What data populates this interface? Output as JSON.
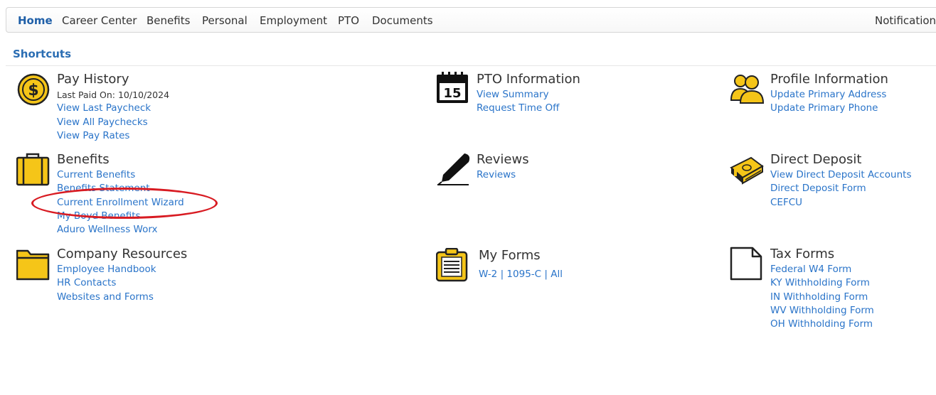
{
  "nav": {
    "items": [
      "Home",
      "Career Center",
      "Benefits",
      "Personal",
      "Employment",
      "PTO",
      "Documents"
    ],
    "right": "Notifications"
  },
  "shortcuts": {
    "title": "Shortcuts",
    "pay_history": {
      "icon": "dollar-coin-icon",
      "title": "Pay History",
      "meta": "Last Paid On: 10/10/2024",
      "links": [
        "View Last Paycheck",
        "View All Paychecks",
        "View Pay Rates"
      ]
    },
    "pto_information": {
      "icon": "calendar-icon",
      "calendar_day": "15",
      "title": "PTO Information",
      "links": [
        "View Summary",
        "Request Time Off"
      ]
    },
    "profile_information": {
      "icon": "people-icon",
      "title": "Profile Information",
      "links": [
        "Update Primary Address",
        "Update Primary Phone"
      ]
    },
    "benefits": {
      "icon": "briefcase-icon",
      "title": "Benefits",
      "links": [
        "Current Benefits",
        "Benefits Statement",
        "Current Enrollment Wizard",
        "My Boyd Benefits",
        "Aduro Wellness Worx"
      ]
    },
    "reviews": {
      "icon": "pen-icon",
      "title": "Reviews",
      "links": [
        "Reviews"
      ]
    },
    "direct_deposit": {
      "icon": "money-stack-icon",
      "title": "Direct Deposit",
      "links": [
        "View Direct Deposit Accounts",
        "Direct Deposit Form",
        "CEFCU"
      ]
    },
    "company_resources": {
      "icon": "folder-icon",
      "title": "Company Resources",
      "links": [
        "Employee Handbook",
        "HR Contacts",
        "Websites and Forms"
      ]
    },
    "my_forms": {
      "icon": "clipboard-icon",
      "title": "My Forms",
      "links": [
        "W-2",
        "1095-C",
        "All"
      ],
      "separator": "|"
    },
    "tax_forms": {
      "icon": "document-icon",
      "title": "Tax Forms",
      "links": [
        "Federal W4 Form",
        "KY Withholding Form",
        "IN Withholding Form",
        "WV Withholding Form",
        "OH Withholding Form"
      ]
    }
  },
  "colors": {
    "link": "#2a74c9",
    "accent": "#1f5fa8",
    "icon_gold": "#f5c518",
    "highlight": "#d81b22"
  }
}
